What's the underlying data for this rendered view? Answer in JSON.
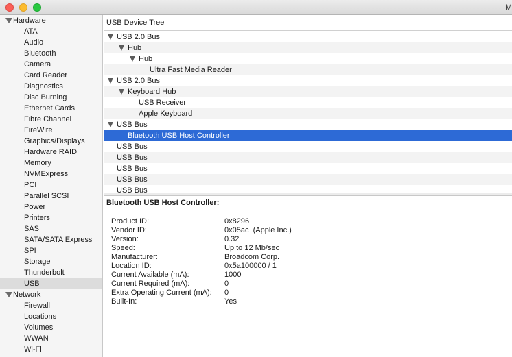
{
  "window": {
    "title": "M"
  },
  "sidebar": {
    "groups": [
      {
        "label": "Hardware",
        "items": [
          "ATA",
          "Audio",
          "Bluetooth",
          "Camera",
          "Card Reader",
          "Diagnostics",
          "Disc Burning",
          "Ethernet Cards",
          "Fibre Channel",
          "FireWire",
          "Graphics/Displays",
          "Hardware RAID",
          "Memory",
          "NVMExpress",
          "PCI",
          "Parallel SCSI",
          "Power",
          "Printers",
          "SAS",
          "SATA/SATA Express",
          "SPI",
          "Storage",
          "Thunderbolt",
          "USB"
        ]
      },
      {
        "label": "Network",
        "items": [
          "Firewall",
          "Locations",
          "Volumes",
          "WWAN",
          "Wi-Fi"
        ]
      }
    ],
    "selected": "USB"
  },
  "tree": {
    "header": "USB Device Tree",
    "rows": [
      {
        "label": "USB 2.0 Bus",
        "depth": 0,
        "expanded": true
      },
      {
        "label": "Hub",
        "depth": 1,
        "expanded": true
      },
      {
        "label": "Hub",
        "depth": 2,
        "expanded": true
      },
      {
        "label": "Ultra Fast Media Reader",
        "depth": 3
      },
      {
        "label": "USB 2.0 Bus",
        "depth": 0,
        "expanded": true
      },
      {
        "label": "Keyboard Hub",
        "depth": 1,
        "expanded": true
      },
      {
        "label": "USB Receiver",
        "depth": 2
      },
      {
        "label": "Apple Keyboard",
        "depth": 2
      },
      {
        "label": "USB Bus",
        "depth": 0,
        "expanded": true
      },
      {
        "label": "Bluetooth USB Host Controller",
        "depth": 1,
        "selected": true
      },
      {
        "label": "USB Bus",
        "depth": 0
      },
      {
        "label": "USB Bus",
        "depth": 0
      },
      {
        "label": "USB Bus",
        "depth": 0
      },
      {
        "label": "USB Bus",
        "depth": 0
      },
      {
        "label": "USB Bus",
        "depth": 0
      }
    ]
  },
  "detail": {
    "title": "Bluetooth USB Host Controller:",
    "fields": [
      {
        "key": "Product ID:",
        "value": "0x8296"
      },
      {
        "key": "Vendor ID:",
        "value": "0x05ac  (Apple Inc.)"
      },
      {
        "key": "Version:",
        "value": "0.32"
      },
      {
        "key": "Speed:",
        "value": "Up to 12 Mb/sec"
      },
      {
        "key": "Manufacturer:",
        "value": "Broadcom Corp."
      },
      {
        "key": "Location ID:",
        "value": "0x5a100000 / 1"
      },
      {
        "key": "Current Available (mA):",
        "value": "1000"
      },
      {
        "key": "Current Required (mA):",
        "value": "0"
      },
      {
        "key": "Extra Operating Current (mA):",
        "value": "0"
      },
      {
        "key": "Built-In:",
        "value": "Yes"
      }
    ]
  },
  "colors": {
    "selection": "#2d6ad6",
    "sidebar_selected": "#dcdcdc"
  }
}
